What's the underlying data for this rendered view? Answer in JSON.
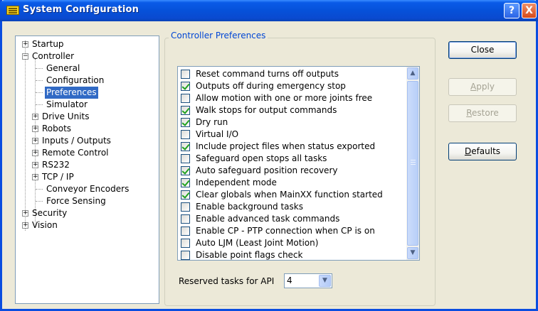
{
  "window": {
    "title": "System Configuration",
    "help_label": "?",
    "close_label": "X"
  },
  "tree": {
    "items": [
      {
        "label": "Startup",
        "expander": "+"
      },
      {
        "label": "Controller",
        "expander": "−"
      },
      {
        "label": "General"
      },
      {
        "label": "Configuration"
      },
      {
        "label": "Preferences",
        "selected": true
      },
      {
        "label": "Simulator"
      },
      {
        "label": "Drive Units",
        "expander": "+"
      },
      {
        "label": "Robots",
        "expander": "+"
      },
      {
        "label": "Inputs / Outputs",
        "expander": "+"
      },
      {
        "label": "Remote Control",
        "expander": "+"
      },
      {
        "label": "RS232",
        "expander": "+"
      },
      {
        "label": "TCP / IP",
        "expander": "+"
      },
      {
        "label": "Conveyor Encoders"
      },
      {
        "label": "Force Sensing"
      },
      {
        "label": "Security",
        "expander": "+"
      },
      {
        "label": "Vision",
        "expander": "+"
      }
    ]
  },
  "preferences": {
    "group_title": "Controller Preferences",
    "options": [
      {
        "label": "Reset command turns off outputs",
        "checked": false
      },
      {
        "label": "Outputs off during emergency stop",
        "checked": true
      },
      {
        "label": "Allow motion with one or more joints free",
        "checked": false
      },
      {
        "label": "Walk stops for output commands",
        "checked": true
      },
      {
        "label": "Dry run",
        "checked": true
      },
      {
        "label": "Virtual I/O",
        "checked": false
      },
      {
        "label": "Include project files when status exported",
        "checked": true
      },
      {
        "label": "Safeguard open stops all tasks",
        "checked": false
      },
      {
        "label": "Auto safeguard position recovery",
        "checked": true
      },
      {
        "label": "Independent mode",
        "checked": true
      },
      {
        "label": "Clear globals when MainXX function started",
        "checked": true
      },
      {
        "label": "Enable background tasks",
        "checked": false
      },
      {
        "label": "Enable advanced task commands",
        "checked": false
      },
      {
        "label": "Enable CP - PTP connection when CP is on",
        "checked": false
      },
      {
        "label": "Auto LJM (Least Joint Motion)",
        "checked": false
      },
      {
        "label": "Disable point flags check",
        "checked": false
      }
    ],
    "reserved_label": "Reserved tasks for API",
    "reserved_value": "4"
  },
  "buttons": {
    "close": "Close",
    "apply_ul": "A",
    "apply_rest": "pply",
    "restore_ul": "R",
    "restore_rest": "estore",
    "defaults_ul": "D",
    "defaults_rest": "efaults"
  },
  "scroll": {
    "up": "▲",
    "down": "▼"
  },
  "combo_arrow": "▼",
  "colors": {
    "titlebar": "#0a5be8",
    "selection": "#316ac5",
    "group_title": "#0046d5",
    "dialog_bg": "#ece9d8"
  }
}
